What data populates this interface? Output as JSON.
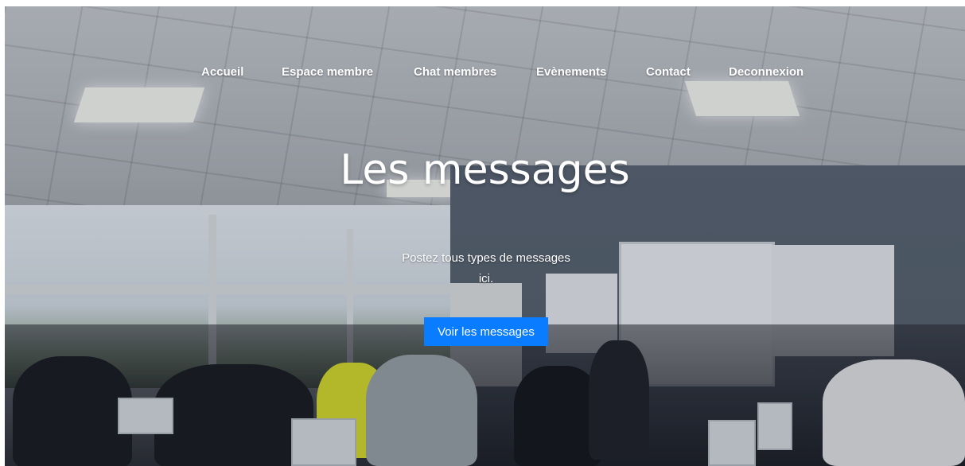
{
  "nav": {
    "items": [
      {
        "label": "Accueil"
      },
      {
        "label": "Espace membre"
      },
      {
        "label": "Chat membres"
      },
      {
        "label": "Evènements"
      },
      {
        "label": "Contact"
      },
      {
        "label": "Deconnexion"
      }
    ]
  },
  "hero": {
    "title": "Les messages",
    "subtitle": "Postez tous types de messages ici.",
    "button_label": "Voir les messages",
    "background_image": "classroom-photo"
  },
  "colors": {
    "button": "#0a7cff",
    "text": "#ffffff"
  }
}
